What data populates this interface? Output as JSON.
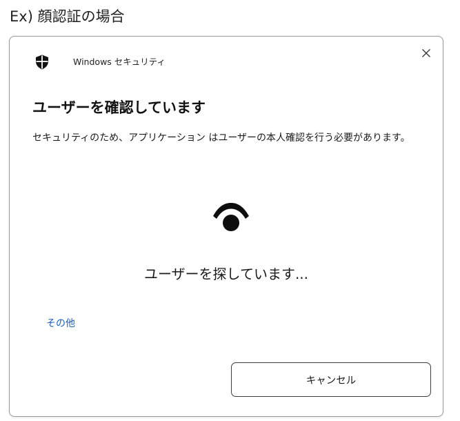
{
  "caption": "Ex) 顔認証の場合",
  "dialog": {
    "app_title": "Windows セキュリティ",
    "heading": "ユーザーを確認しています",
    "description": "セキュリティのため、アプリケーション はユーザーの本人確認を行う必要があります。",
    "status": "ユーザーを探しています...",
    "more_link": "その他",
    "cancel_label": "キャンセル"
  },
  "icons": {
    "app": "shield-icon",
    "close": "close-icon",
    "face": "eye-icon"
  },
  "colors": {
    "link": "#1a5fb4",
    "border": "#9a9a9a",
    "button_border": "#3c3c3c",
    "icon": "#111111"
  }
}
